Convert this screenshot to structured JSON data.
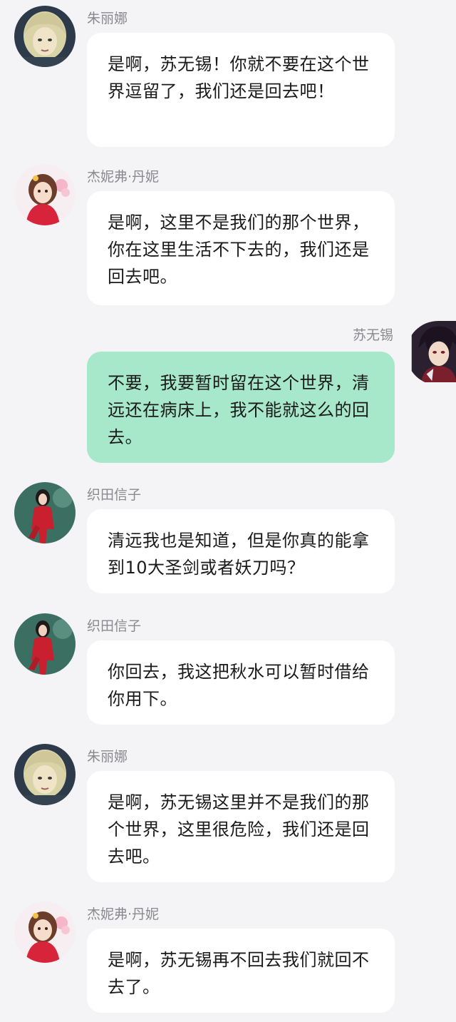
{
  "messages": [
    {
      "sender": "朱丽娜",
      "avatar_icon": "zhulina-avatar-icon",
      "side": "left",
      "text": "是啊，苏无锡！你就不要在这个世界逗留了，我们还是回去吧！"
    },
    {
      "sender": "杰妮弗·丹妮",
      "avatar_icon": "jennifer-avatar-icon",
      "side": "left",
      "text": "是啊，这里不是我们的那个世界，你在这里生活不下去的，我们还是回去吧。"
    },
    {
      "sender": "苏无锡",
      "avatar_icon": "suwuxi-avatar-icon",
      "side": "right",
      "text": "不要，我要暂时留在这个世界，清远还在病床上，我不能就这么的回去。"
    },
    {
      "sender": "织田信子",
      "avatar_icon": "oda-nobuko-avatar-icon",
      "side": "left",
      "text": "清远我也是知道，但是你真的能拿到10大圣剑或者妖刀吗？"
    },
    {
      "sender": "织田信子",
      "avatar_icon": "oda-nobuko-avatar-icon",
      "side": "left",
      "text": "你回去，我这把秋水可以暂时借给你用下。"
    },
    {
      "sender": "朱丽娜",
      "avatar_icon": "zhulina-avatar-icon",
      "side": "left",
      "text": "是啊，苏无锡这里并不是我们的那个世界，这里很危险，我们还是回去吧。"
    },
    {
      "sender": "杰妮弗·丹妮",
      "avatar_icon": "jennifer-avatar-icon",
      "side": "left",
      "text": "是啊，苏无锡再不回去我们就回不去了。"
    }
  ],
  "colors": {
    "background": "#f4f4f7",
    "bubble_incoming": "#ffffff",
    "bubble_outgoing": "#a6e8c9",
    "name_text": "#8a8a8e",
    "message_text": "#1a1a1a"
  }
}
